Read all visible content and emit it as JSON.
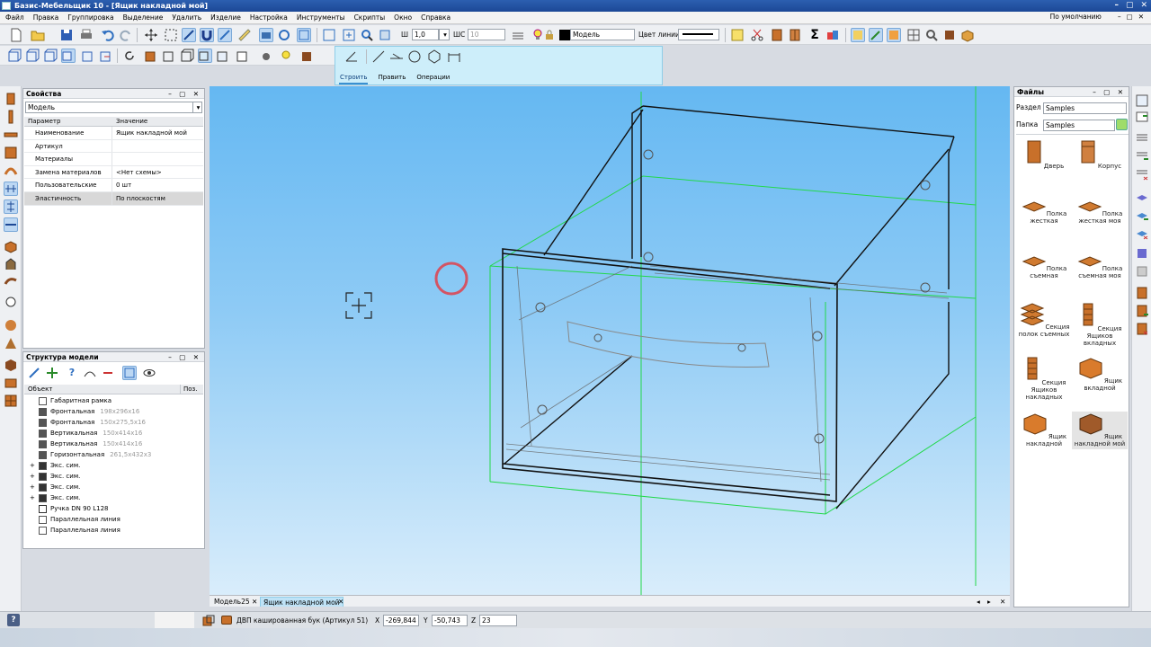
{
  "window": {
    "title": "Базис-Мебельщик 10 - [Ящик накладной мой]",
    "controls": [
      "–",
      "▢",
      "✕"
    ]
  },
  "menu": {
    "items": [
      "Файл",
      "Правка",
      "Группировка",
      "Выделение",
      "Удалить",
      "Изделие",
      "Настройка",
      "Инструменты",
      "Скрипты",
      "Окно",
      "Справка"
    ],
    "view_default": "По умолчанию",
    "mdi_controls": [
      "–",
      "▢",
      "✕"
    ]
  },
  "toolbar": {
    "sh_label": "Ш",
    "sh_value": "1,0",
    "shs_label": "ШС",
    "shs_value": "10",
    "layer_value": "Модель",
    "line_color_label": "Цвет линии"
  },
  "command_panel": {
    "tabs": [
      "Строить",
      "Править",
      "Операции"
    ],
    "active_tab": "Строить"
  },
  "properties": {
    "title": "Свойства",
    "controls": "– ▢ ✕",
    "selector": "Модель",
    "columns": [
      "Параметр",
      "Значение"
    ],
    "rows": [
      {
        "param": "Наименование",
        "value": "Ящик накладной мой"
      },
      {
        "param": "Артикул",
        "value": ""
      },
      {
        "param": "Материалы",
        "value": ""
      },
      {
        "param": "Замена материалов",
        "value": "<Нет схемы>"
      },
      {
        "param": "Пользовательские",
        "value": "0 шт"
      },
      {
        "param": "Эластичность",
        "value": "По плоскостям"
      }
    ]
  },
  "structure": {
    "title": "Структура модели",
    "controls": "– ▢ ✕",
    "columns": [
      "Объект",
      "Поз."
    ],
    "rows": [
      {
        "name": "Габаритная рамка",
        "dim": "",
        "expand": ""
      },
      {
        "name": "Фронтальная",
        "dim": "198x296x16",
        "expand": ""
      },
      {
        "name": "Фронтальная",
        "dim": "150x275,5x16",
        "expand": ""
      },
      {
        "name": "Вертикальная",
        "dim": "150x414x16",
        "expand": ""
      },
      {
        "name": "Вертикальная",
        "dim": "150x414x16",
        "expand": ""
      },
      {
        "name": "Горизонтальная",
        "dim": "261,5x432x3",
        "expand": ""
      },
      {
        "name": "Экс. сим.",
        "dim": "",
        "expand": "+"
      },
      {
        "name": "Экс. сим.",
        "dim": "",
        "expand": "+"
      },
      {
        "name": "Экс. сим.",
        "dim": "",
        "expand": "+"
      },
      {
        "name": "Экс. сим.",
        "dim": "",
        "expand": "+"
      },
      {
        "name": "Ручка DN 90 L128",
        "dim": "",
        "expand": ""
      },
      {
        "name": "Параллельная линия",
        "dim": "",
        "expand": ""
      },
      {
        "name": "Параллельная линия",
        "dim": "",
        "expand": ""
      }
    ]
  },
  "viewport_tabs": {
    "tabs": [
      "Модель25",
      "Ящик накладной мой"
    ],
    "active": 1,
    "close": "✕"
  },
  "files": {
    "title": "Файлы",
    "controls": "– ▢ ✕",
    "section_label": "Раздел",
    "section_value": "Samples",
    "folder_label": "Папка",
    "folder_value": "Samples",
    "items": [
      {
        "label": "Дверь",
        "color": "#c8702a"
      },
      {
        "label": "Корпус",
        "color": "#c8702a"
      },
      {
        "label": "Полка жесткая",
        "color": "#d07a30"
      },
      {
        "label": "Полка жесткая моя",
        "color": "#d07a30"
      },
      {
        "label": "Полка съемная",
        "color": "#d07a30"
      },
      {
        "label": "Полка съемная моя",
        "color": "#d07a30"
      },
      {
        "label": "Секция полок съемных",
        "color": "#c8702a"
      },
      {
        "label": "Секция Ящиков вкладных",
        "color": "#c8702a"
      },
      {
        "label": "Секция Ящиков накладных",
        "color": "#c8702a"
      },
      {
        "label": "Ящик вкладной",
        "color": "#d97b2c"
      },
      {
        "label": "Ящик накладной",
        "color": "#d97b2c"
      },
      {
        "label": "Ящик накладной мой",
        "color": "#a05a2a"
      }
    ]
  },
  "statusbar": {
    "help": "?",
    "material": "ДВП кашированная бук (Артикул 51)",
    "x_label": "X",
    "x_value": "-269,844",
    "y_label": "Y",
    "y_value": "-50,743",
    "z_label": "Z",
    "z_value": "23"
  },
  "colors": {
    "accent": "#3a8fd0",
    "selection": "#bcd7f3",
    "gizmo": "#e0404a",
    "bbox": "#22d84a"
  }
}
